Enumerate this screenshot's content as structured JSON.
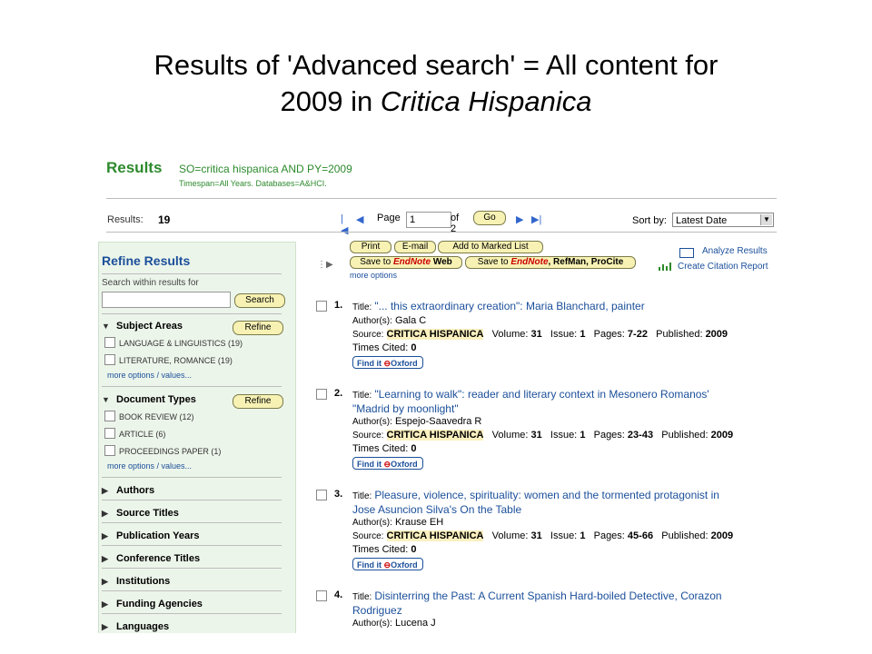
{
  "slide": {
    "title_line1": "Results of 'Advanced search' = All content for",
    "title_line2_prefix": "2009 in ",
    "title_line2_italic": "Critica Hispanica"
  },
  "header": {
    "title": "Results",
    "query": "SO=critica hispanica AND PY=2009",
    "scope": "Timespan=All Years. Databases=A&HCI."
  },
  "results_bar": {
    "count_label": "Results:",
    "count": "19",
    "page_label": "Page",
    "page_value": "1",
    "of_pages": "of 2",
    "go_label": "Go",
    "sort_label": "Sort by:",
    "sort_value": "Latest Date"
  },
  "sidebar": {
    "title": "Refine Results",
    "search_label": "Search within results for",
    "search_button": "Search",
    "refine_label": "Refine",
    "subject_areas": {
      "heading": "Subject Areas",
      "items": [
        "LANGUAGE & LINGUISTICS (19)",
        "LITERATURE, ROMANCE (19)"
      ],
      "more": "more options / values..."
    },
    "document_types": {
      "heading": "Document Types",
      "items": [
        "BOOK REVIEW (12)",
        "ARTICLE (6)",
        "PROCEEDINGS PAPER (1)"
      ],
      "more": "more options / values..."
    },
    "collapsed": [
      "Authors",
      "Source Titles",
      "Publication Years",
      "Conference Titles",
      "Institutions",
      "Funding Agencies",
      "Languages"
    ]
  },
  "toolbar": {
    "print": "Print",
    "email": "E-mail",
    "add_marked": "Add to Marked List",
    "save_to": "Save to",
    "endnote": "EndNote",
    "web": "Web",
    "save_to_2": "Save to",
    "endnote_2": "EndNote",
    "refman": ", RefMan, ProCite",
    "more_options": "more options",
    "analyze": "Analyze Results",
    "citation": "Create Citation Report"
  },
  "records": [
    {
      "num": "1.",
      "title": "\"... this extraordinary creation\": Maria Blanchard, painter",
      "title2": "",
      "authors": "Gala C",
      "source": "CRITICA HISPANICA",
      "volume": "31",
      "issue": "1",
      "pages": "7-22",
      "published": "2009",
      "cited": "0"
    },
    {
      "num": "2.",
      "title": "\"Learning to walk\": reader and literary context in Mesonero Romanos'",
      "title2": "\"Madrid by moonlight\"",
      "authors": "Espejo-Saavedra R",
      "source": "CRITICA HISPANICA",
      "volume": "31",
      "issue": "1",
      "pages": "23-43",
      "published": "2009",
      "cited": "0"
    },
    {
      "num": "3.",
      "title": "Pleasure, violence, spirituality: women and the tormented protagonist in",
      "title2": "Jose Asuncion Silva's On the Table",
      "authors": "Krause EH",
      "source": "CRITICA HISPANICA",
      "volume": "31",
      "issue": "1",
      "pages": "45-66",
      "published": "2009",
      "cited": "0"
    },
    {
      "num": "4.",
      "title": "Disinterring the Past: A Current Spanish Hard-boiled Detective, Corazon",
      "title2": "Rodriguez",
      "authors": "Lucena J"
    }
  ],
  "labels": {
    "title": "Title:",
    "authors": "Author(s):",
    "source": "Source:",
    "volume": "Volume:",
    "issue": "Issue:",
    "pages": "Pages:",
    "published": "Published:",
    "cited": "Times Cited:",
    "findit": "Find it",
    "oxford": "Oxford"
  }
}
